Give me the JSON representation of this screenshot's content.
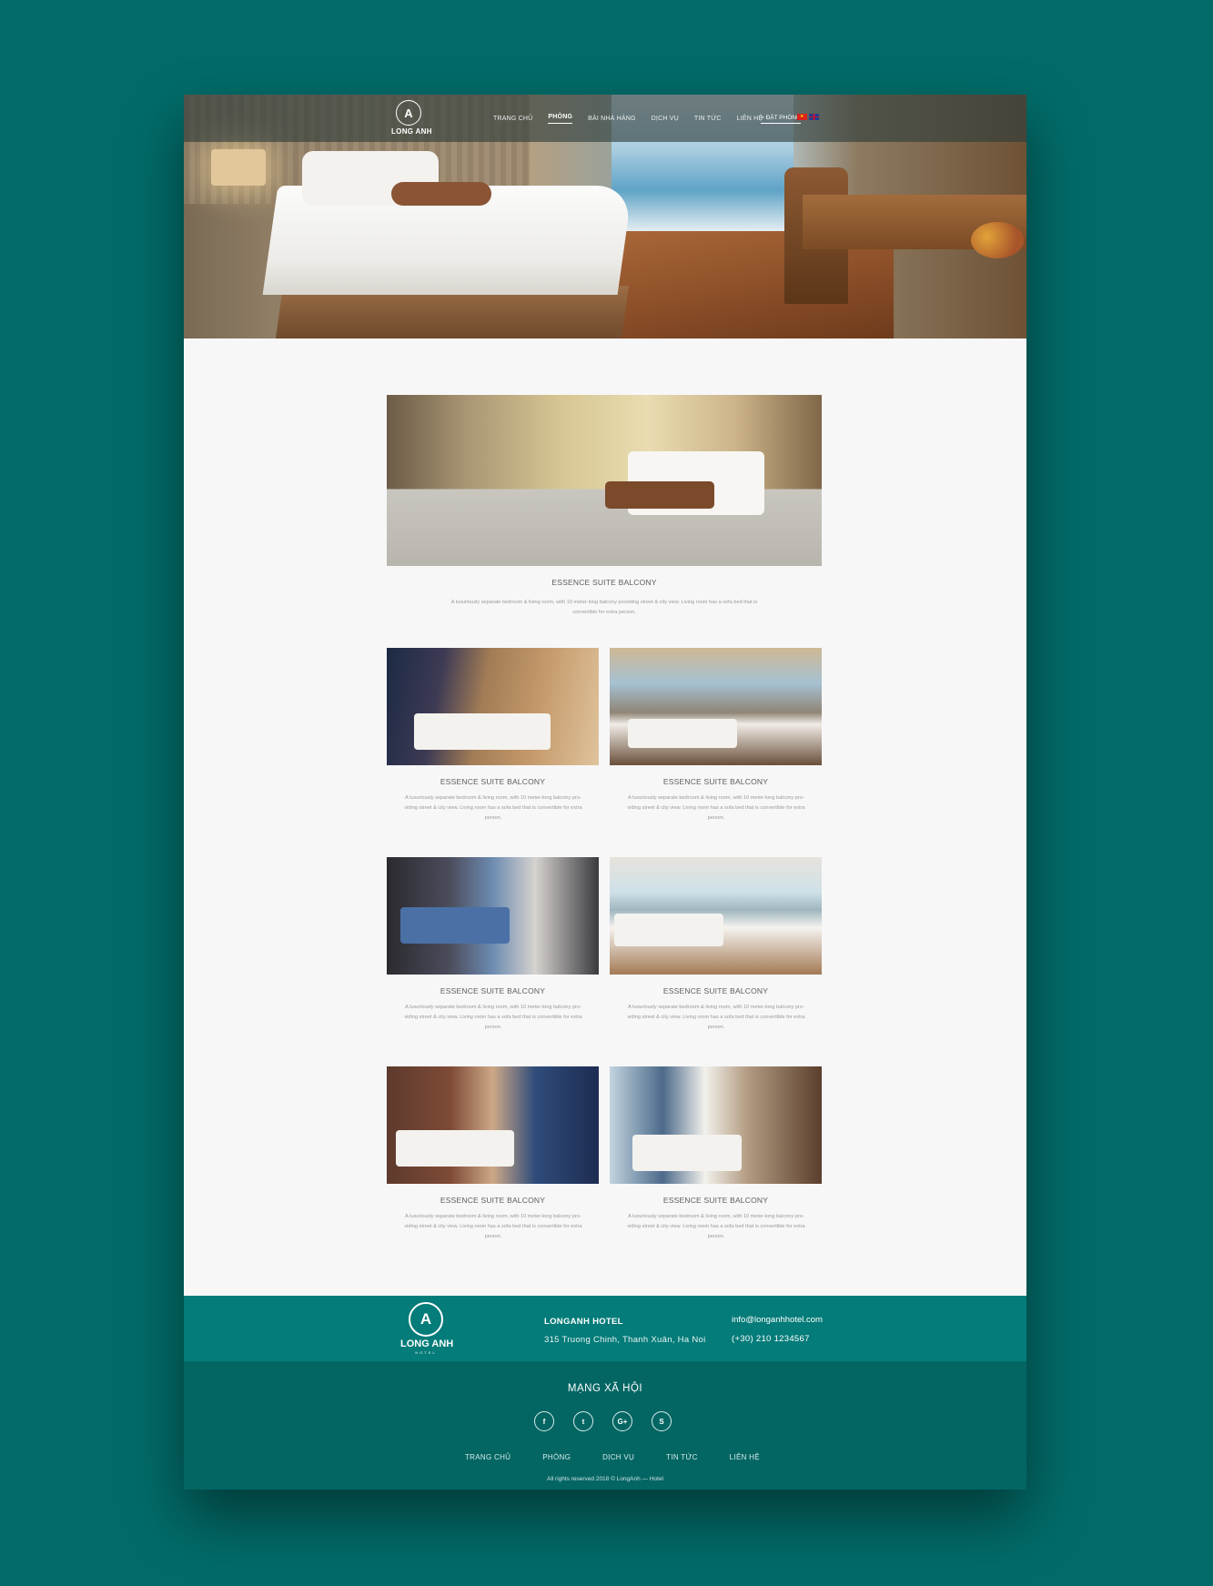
{
  "header": {
    "logo_text": "LONG ANH",
    "nav": [
      "TRANG CHỦ",
      "PHÒNG",
      "BÀI NHÀ HÀNG",
      "DỊCH VỤ",
      "TIN TỨC",
      "LIÊN HỆ"
    ],
    "active_nav": "PHÒNG",
    "book_label": "> ĐẶT PHÒNG",
    "languages": [
      "vi-flag",
      "en-flag"
    ]
  },
  "featured": {
    "title": "ESSENCE SUITE BALCONY",
    "desc_line1": "A luxuriously separate bedroom & living room, with 10 meter-long balcony providing street & city view. Living room has a sofa bed that is",
    "desc_line2": "convertible for extra person."
  },
  "rooms": [
    {
      "title": "ESSENCE SUITE BALCONY",
      "desc": [
        "A luxuriously separate bedroom & living room, with 10 meter-long balcony pro-",
        "viding street & city view. Living room has a sofa bed that is convertible for extra",
        "person."
      ]
    },
    {
      "title": "ESSENCE SUITE BALCONY",
      "desc": [
        "A luxuriously separate bedroom & living room, with 10 meter-long balcony pro-",
        "viding street & city view. Living room has a sofa bed that is convertible for extra",
        "person."
      ]
    },
    {
      "title": "ESSENCE SUITE BALCONY",
      "desc": [
        "A luxuriously separate bedroom & living room, with 10 meter-long balcony pro-",
        "viding street & city view. Living room has a sofa bed that is convertible for extra",
        "person."
      ]
    },
    {
      "title": "ESSENCE SUITE BALCONY",
      "desc": [
        "A luxuriously separate bedroom & living room, with 10 meter-long balcony pro-",
        "viding street & city view. Living room has a sofa bed that is convertible for extra",
        "person."
      ]
    },
    {
      "title": "ESSENCE SUITE BALCONY",
      "desc": [
        "A luxuriously separate bedroom & living room, with 10 meter-long balcony pro-",
        "viding street & city view. Living room has a sofa bed that is convertible for extra",
        "person."
      ]
    },
    {
      "title": "ESSENCE SUITE BALCONY",
      "desc": [
        "A luxuriously separate bedroom & living room, with 10 meter-long balcony pro-",
        "viding street & city view. Living room has a sofa bed that is convertible for extra",
        "person."
      ]
    }
  ],
  "footer": {
    "logo_text": "LONG ANH",
    "logo_sub": "HOTEL",
    "hotel_name": "LONGANH HOTEL",
    "address": "315 Truong Chinh, Thanh Xuân, Ha Noi",
    "email": "info@longanhhotel.com",
    "phone": "(+30) 210 1234567",
    "social_title": "MẠNG XÃ HỘI",
    "social_icons": [
      {
        "name": "facebook-icon",
        "glyph": "f"
      },
      {
        "name": "twitter-icon",
        "glyph": "t"
      },
      {
        "name": "google-plus-icon",
        "glyph": "G+"
      },
      {
        "name": "skype-icon",
        "glyph": "S"
      }
    ],
    "menu": [
      "TRANG CHỦ",
      "PHÒNG",
      "DỊCH VỤ",
      "TIN TỨC",
      "LIÊN HỆ"
    ],
    "copyright": "All rights reserved 2018 © LongAnh — Hotel"
  },
  "colors": {
    "background": "#026b68",
    "footer_top": "#047c79",
    "footer_bottom": "#036663"
  }
}
